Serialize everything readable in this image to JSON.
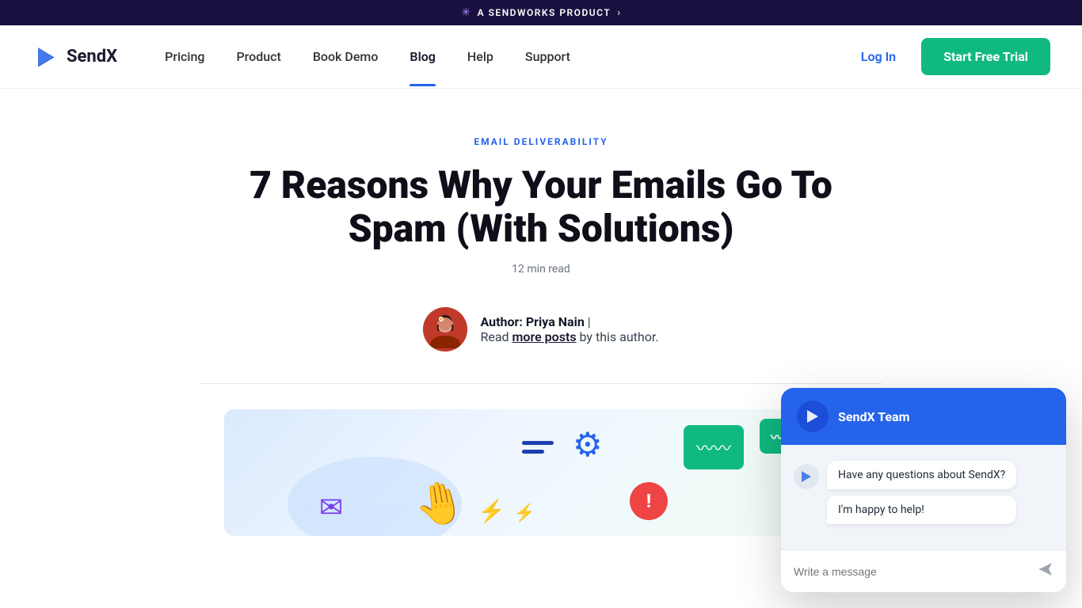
{
  "topBanner": {
    "icon": "❄",
    "text": "A SENDWORKS PRODUCT",
    "chevron": "›"
  },
  "navbar": {
    "logo": {
      "text": "SendX"
    },
    "links": [
      {
        "label": "Pricing",
        "href": "#",
        "active": false
      },
      {
        "label": "Product",
        "href": "#",
        "active": false
      },
      {
        "label": "Book Demo",
        "href": "#",
        "active": false
      },
      {
        "label": "Blog",
        "href": "#",
        "active": true
      },
      {
        "label": "Help",
        "href": "#",
        "active": false
      },
      {
        "label": "Support",
        "href": "#",
        "active": false
      }
    ],
    "loginLabel": "Log In",
    "trialLabel": "Start Free Trial"
  },
  "article": {
    "category": "EMAIL DELIVERABILITY",
    "title": "7 Reasons Why Your Emails Go To Spam (With Solutions)",
    "readTime": "12 min read",
    "author": {
      "name": "Priya Nain",
      "prefix": "Author: ",
      "separator": " |",
      "readMoreText": "Read ",
      "readMoreLink": "more posts",
      "readMoreSuffix": " by this author."
    }
  },
  "chat": {
    "teamName": "SendX Team",
    "message1": "Have any questions about SendX?",
    "message2": "I'm happy to help!",
    "inputPlaceholder": "Write a message",
    "closeIcon": "✕"
  }
}
